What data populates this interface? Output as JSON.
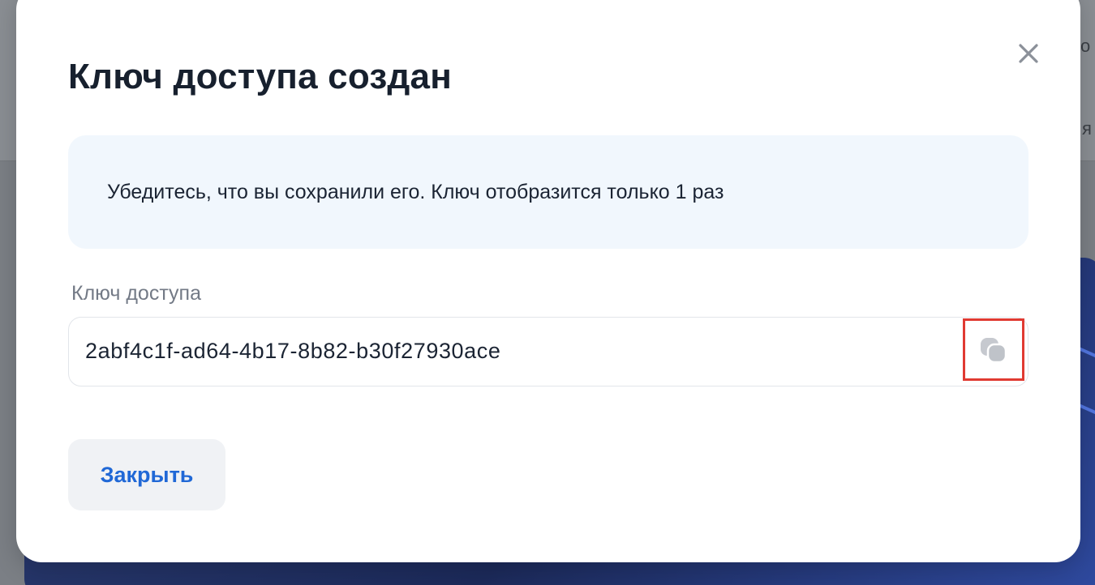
{
  "background": {
    "fragments": [
      "о",
      "я"
    ]
  },
  "modal": {
    "title": "Ключ доступа создан",
    "notice": "Убедитесь, что вы сохранили его. Ключ отобразится только 1 раз",
    "key_label": "Ключ доступа",
    "key_value": "2abf4c1f-ad64-4b17-8b82-b30f27930ace",
    "close_button_label": "Закрыть",
    "close_icon": "close-icon",
    "copy_icon": "copy-icon",
    "copy_highlight_color": "#e03a32",
    "accent_color": "#2068d6"
  }
}
